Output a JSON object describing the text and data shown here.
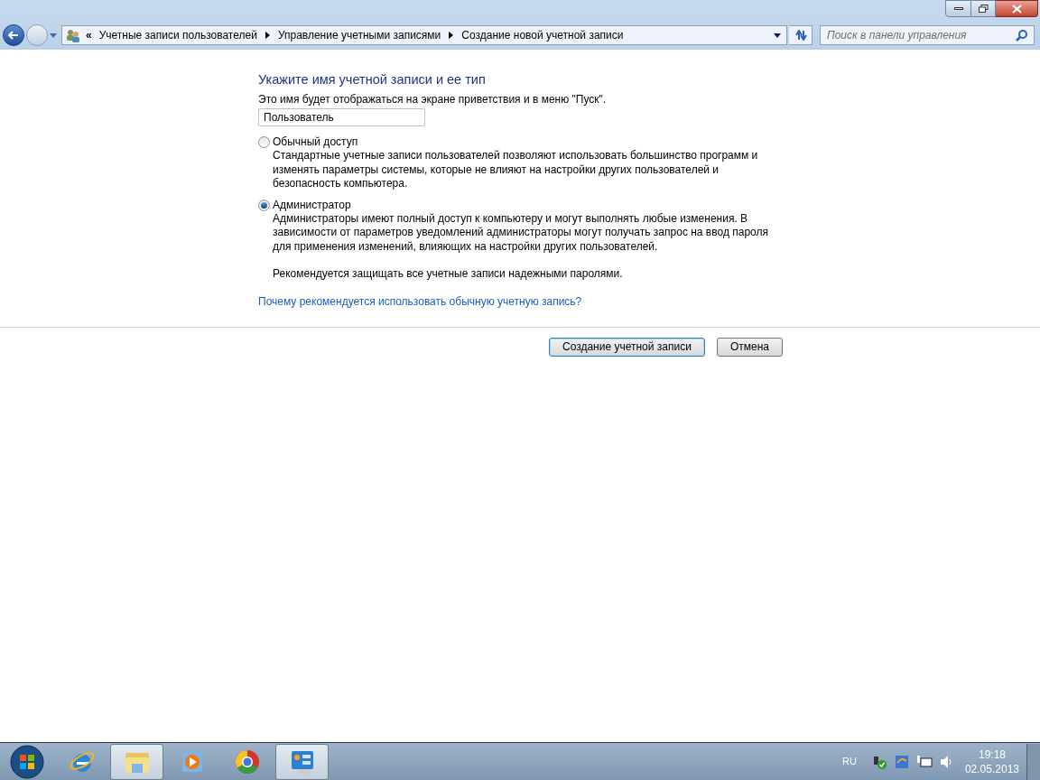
{
  "address_bar": {
    "overflow": "«",
    "breadcrumbs": [
      "Учетные записи пользователей",
      "Управление учетными записями",
      "Создание новой учетной записи"
    ]
  },
  "search": {
    "placeholder": "Поиск в панели управления"
  },
  "form": {
    "title": "Укажите имя учетной записи и ее тип",
    "hint": "Это имя будет отображаться на экране приветствия и в меню \"Пуск\".",
    "name_value": "Пользователь",
    "options": [
      {
        "label": "Обычный доступ",
        "selected": false,
        "description": [
          "Стандартные учетные записи пользователей позволяют использовать большинство программ и изменять параметры системы, которые не влияют на настройки других пользователей и безопасность компьютера."
        ]
      },
      {
        "label": "Администратор",
        "selected": true,
        "description": [
          "Администраторы имеют полный доступ к компьютеру и могут выполнять любые изменения. В зависимости от параметров уведомлений администраторы могут получать запрос на ввод пароля для применения изменений, влияющих на настройки других пользователей.",
          "Рекомендуется защищать все учетные записи надежными паролями."
        ]
      }
    ],
    "link": "Почему рекомендуется использовать обычную учетную запись?",
    "buttons": [
      {
        "label": "Создание учетной записи",
        "default": true
      },
      {
        "label": "Отмена",
        "default": false
      }
    ]
  },
  "taskbar": {
    "items": [
      {
        "kind": "ie",
        "active": false
      },
      {
        "kind": "explorer",
        "active": true
      },
      {
        "kind": "media",
        "active": false
      },
      {
        "kind": "chrome",
        "active": false
      },
      {
        "kind": "control-panel",
        "active": true
      }
    ],
    "language": "RU",
    "time": "19:18",
    "date": "02.05.2013"
  }
}
